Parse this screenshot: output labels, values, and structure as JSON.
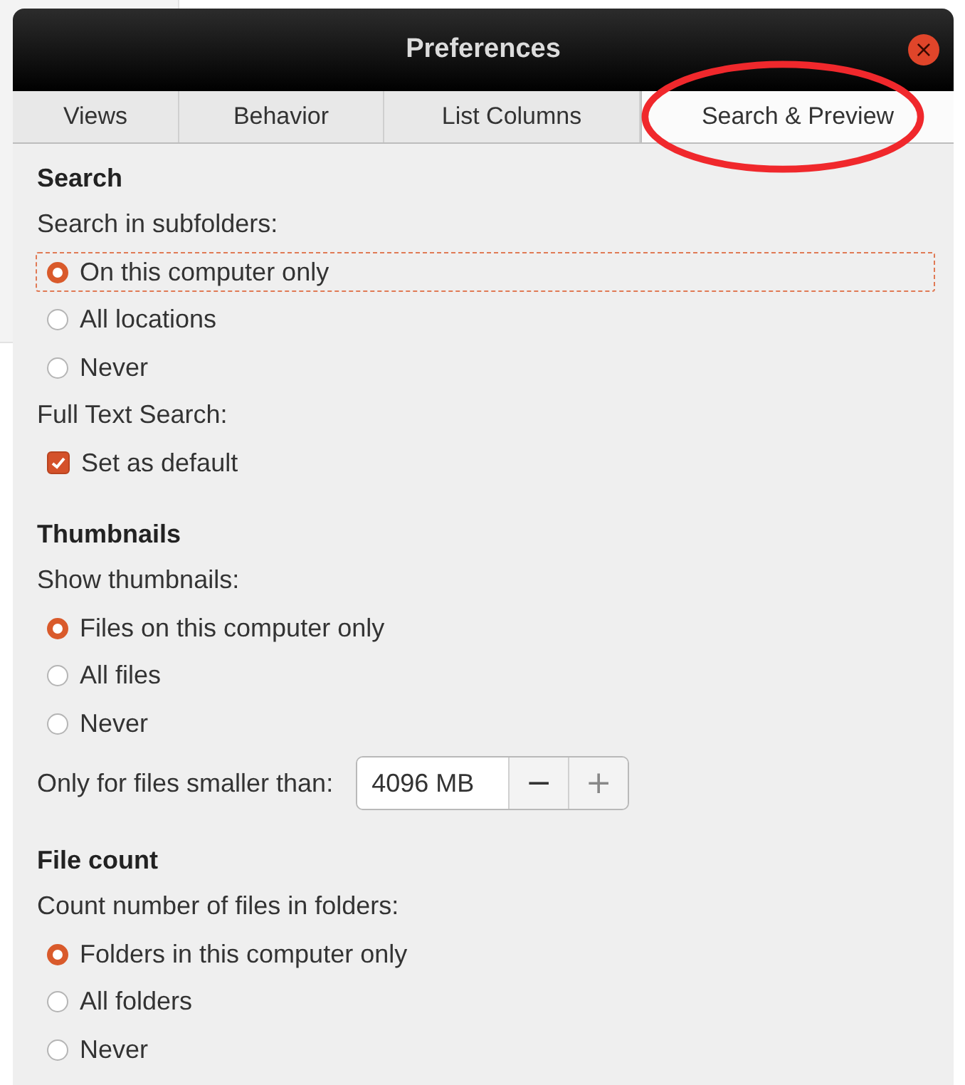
{
  "window": {
    "title": "Preferences",
    "close_button": "×"
  },
  "tabs": [
    {
      "label": "Views",
      "selected": false
    },
    {
      "label": "Behavior",
      "selected": false
    },
    {
      "label": "List Columns",
      "selected": false
    },
    {
      "label": "Search & Preview",
      "selected": true,
      "circled": true
    }
  ],
  "sections": [
    {
      "title": "Search",
      "rows": [
        {
          "kind": "label",
          "text": "Search in subfolders:"
        },
        {
          "kind": "radio",
          "label": "On this computer only",
          "selected": true,
          "focused": true
        },
        {
          "kind": "radio",
          "label": "All locations",
          "selected": false,
          "focused": false
        },
        {
          "kind": "radio",
          "label": "Never",
          "selected": false,
          "focused": false
        },
        {
          "kind": "label",
          "text": "Full Text Search:"
        },
        {
          "kind": "checkbox",
          "label": "Set as default",
          "checked": true
        }
      ]
    },
    {
      "title": "Thumbnails",
      "rows": [
        {
          "kind": "label",
          "text": "Show thumbnails:"
        },
        {
          "kind": "radio",
          "label": "Files on this computer only",
          "selected": true,
          "focused": false
        },
        {
          "kind": "radio",
          "label": "All files",
          "selected": false,
          "focused": false
        },
        {
          "kind": "radio",
          "label": "Never",
          "selected": false,
          "focused": false
        },
        {
          "kind": "spin",
          "label": "Only for files smaller than:",
          "value": "4096 MB",
          "minus": "−",
          "plus": "+"
        }
      ]
    },
    {
      "title": "File count",
      "rows": [
        {
          "kind": "label",
          "text": "Count number of files in folders:"
        },
        {
          "kind": "radio",
          "label": "Folders in this computer only",
          "selected": true,
          "focused": false
        },
        {
          "kind": "radio",
          "label": "All folders",
          "selected": false,
          "focused": false
        },
        {
          "kind": "radio",
          "label": "Never",
          "selected": false,
          "focused": false
        }
      ]
    }
  ]
}
